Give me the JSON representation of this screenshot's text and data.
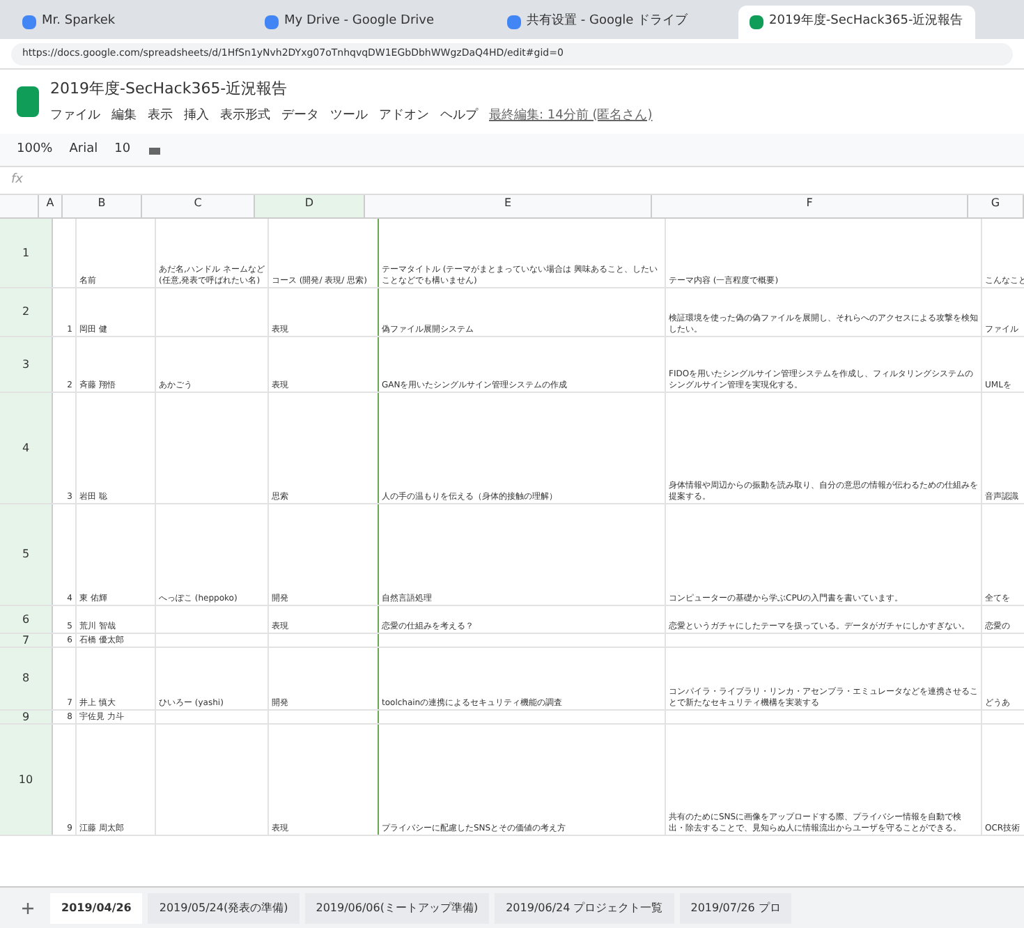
{
  "browser_tabs": [
    {
      "title": "Mr. Sparkek",
      "selected": false
    },
    {
      "title": "My Drive - Google Drive",
      "selected": false
    },
    {
      "title": "共有设置 - Google ドライブ",
      "selected": false
    },
    {
      "title": "2019年度-SecHack365-近況報告",
      "selected": true
    }
  ],
  "address": "https://docs.google.com/spreadsheets/d/1HfSn1yNvh2DYxg07oTnhqvqDW1EGbDbhWWgzDaQ4HD/edit#gid=0",
  "document": {
    "title": "2019年度-SecHack365-近況報告",
    "menu": [
      "ファイル",
      "編集",
      "表示",
      "挿入",
      "表示形式",
      "データ",
      "ツール",
      "アドオン",
      "ヘルプ"
    ],
    "last_edit": "最終編集: 14分前 (匿名さん)"
  },
  "toolbar": {
    "zoom": "100%",
    "font": "Arial",
    "size": "10"
  },
  "formula_bar": {
    "label": "fx"
  },
  "columns": [
    "A",
    "B",
    "C",
    "D",
    "E",
    "F",
    "G"
  ],
  "rows": [
    {
      "number": "1",
      "cells": [
        "",
        "名前",
        "あだ名,ハンドル ネームなど (任意,発表で呼ばれたい名)",
        "コース (開発/ 表現/ 思索)",
        "テーマタイトル (テーマがまとまっていない場合は 興味あること、したいことなどでも構いません)",
        "テーマ内容 (一言程度で概要)",
        "こんなこと"
      ]
    },
    {
      "number": "2",
      "cells": [
        "1",
        "岡田 健",
        "",
        "表現",
        "偽ファイル展開システム",
        "検証環境を使った偽の偽ファイルを展開し、それらへのアクセスによる攻撃を検知したい。",
        "ファイル"
      ]
    },
    {
      "number": "3",
      "cells": [
        "2",
        "斉藤 翔悟",
        "あかごう",
        "表現",
        "GANを用いたシングルサイン管理システムの作成",
        "FIDOを用いたシングルサイン管理システムを作成し、フィルタリングシステムのシングルサイン管理を実現化する。",
        "UMLを"
      ]
    },
    {
      "number": "4",
      "cells": [
        "3",
        "岩田 聡",
        "",
        "思索",
        "人の手の温もりを伝える（身体的接触の理解）",
        "身体情報や周辺からの振動を読み取り、自分の意思の情報が伝わるための仕組みを提案する。",
        "音声認識"
      ]
    },
    {
      "number": "5",
      "cells": [
        "4",
        "東 佑輝",
        "へっぽこ (heppoko)",
        "開発",
        "自然言語処理",
        "コンピューターの基礎から学ぶCPUの入門書を書いています。",
        "全てを"
      ]
    },
    {
      "number": "6",
      "cells": [
        "5",
        "荒川 智哉",
        "",
        "表現",
        "恋愛の仕組みを考える？",
        "恋愛というガチャにしたテーマを扱っている。データがガチャにしかすぎない。",
        "恋愛の"
      ]
    },
    {
      "number": "7",
      "cells": [
        "6",
        "石橋 優太郎",
        "",
        "",
        "",
        "",
        ""
      ]
    },
    {
      "number": "8",
      "cells": [
        "7",
        "井上 慎大",
        "ひいろー (yashi)",
        "開発",
        "toolchainの連携によるセキュリティ機能の調査",
        "コンパイラ・ライブラリ・リンカ・アセンブラ・エミュレータなどを連携させることで新たなセキュリティ機構を実装する",
        "どうあ"
      ]
    },
    {
      "number": "9",
      "cells": [
        "8",
        "宇佐見 力斗",
        "",
        "",
        "",
        "",
        ""
      ]
    },
    {
      "number": "10",
      "cells": [
        "9",
        "江藤 周太郎",
        "",
        "表現",
        "プライバシーに配慮したSNSとその価値の考え方",
        "共有のためにSNSに画像をアップロードする際、プライバシー情報を自動で検出・除去することで、見知らぬ人に情報流出からユーザを守ることができる。",
        "OCR技術"
      ]
    }
  ],
  "sheet_tabs": [
    {
      "title": "2019/04/26",
      "selected": true
    },
    {
      "title": "2019/05/24(発表の準備)",
      "selected": false
    },
    {
      "title": "2019/06/06(ミートアップ準備)",
      "selected": false
    },
    {
      "title": "2019/06/24 プロジェクト一覧",
      "selected": false
    },
    {
      "title": "2019/07/26 プロ",
      "selected": false
    }
  ]
}
